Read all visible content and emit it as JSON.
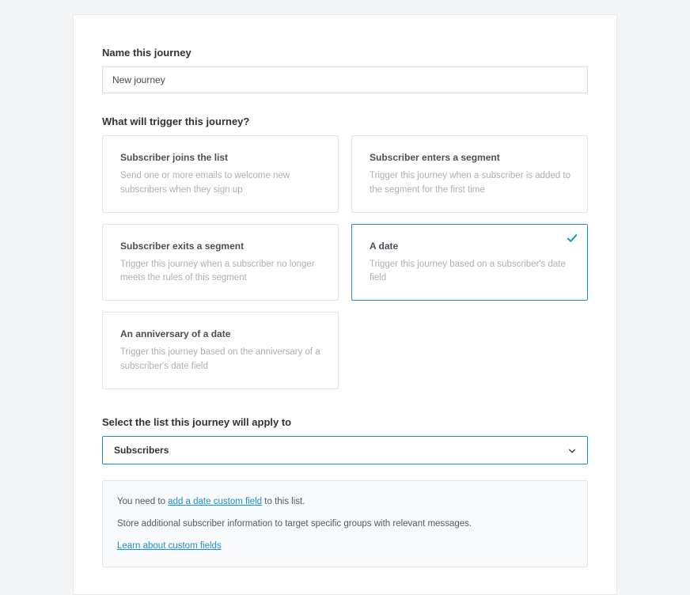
{
  "name_section": {
    "label": "Name this journey",
    "value": "New journey"
  },
  "trigger_section": {
    "label": "What will trigger this journey?",
    "options": [
      {
        "title": "Subscriber joins the list",
        "desc": "Send one or more emails to welcome new subscribers when they sign up",
        "selected": false
      },
      {
        "title": "Subscriber enters a segment",
        "desc": "Trigger this journey when a subscriber is added to the segment for the first time",
        "selected": false
      },
      {
        "title": "Subscriber exits a segment",
        "desc": "Trigger this journey when a subscriber no longer meets the rules of this segment",
        "selected": false
      },
      {
        "title": "A date",
        "desc": "Trigger this journey based on a subscriber's date field",
        "selected": true
      },
      {
        "title": "An anniversary of a date",
        "desc": "Trigger this journey based on the anniversary of a subscriber's date field",
        "selected": false
      }
    ]
  },
  "list_section": {
    "label": "Select the list this journey will apply to",
    "selected": "Subscribers"
  },
  "info_box": {
    "line1_prefix": "You need to ",
    "line1_link": "add a date custom field",
    "line1_suffix": " to this list.",
    "line2": "Store additional subscriber information to target specific groups with relevant messages.",
    "learn_link": "Learn about custom fields"
  }
}
